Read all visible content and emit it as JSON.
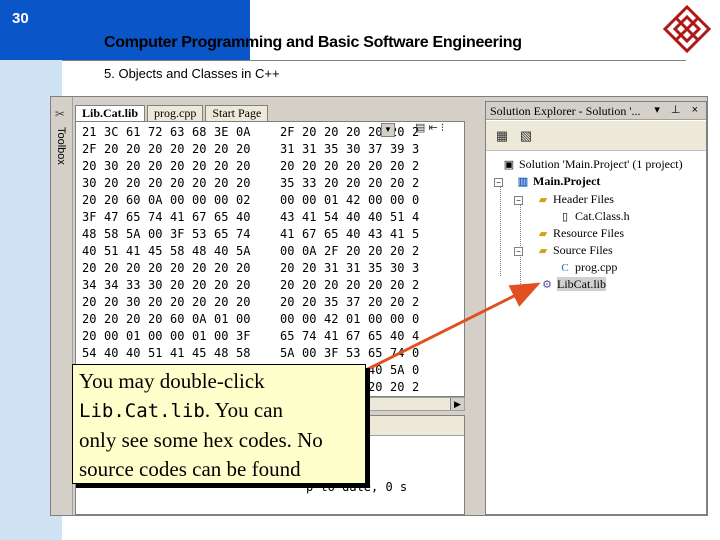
{
  "slide": {
    "number": "30",
    "title": "Computer Programming and Basic Software Engineering",
    "subtitle": "5. Objects and Classes in C++"
  },
  "editor": {
    "tabs": [
      {
        "label": "Lib.Cat.lib",
        "active": true
      },
      {
        "label": "prog.cpp",
        "active": false
      },
      {
        "label": "Start Page",
        "active": false
      }
    ],
    "toolbox_label": "Toolbox",
    "hex_rows": [
      [
        "21",
        "3C",
        "61",
        "72",
        "63",
        "68",
        "3E",
        "0A",
        "",
        "2F",
        "20",
        "20",
        "20",
        "20",
        "20",
        "2"
      ],
      [
        "2F",
        "20",
        "20",
        "20",
        "20",
        "20",
        "20",
        "20",
        "",
        "31",
        "31",
        "35",
        "30",
        "37",
        "39",
        "3"
      ],
      [
        "20",
        "30",
        "20",
        "20",
        "20",
        "20",
        "20",
        "20",
        "",
        "20",
        "20",
        "20",
        "20",
        "20",
        "20",
        "2"
      ],
      [
        "30",
        "20",
        "20",
        "20",
        "20",
        "20",
        "20",
        "20",
        "",
        "35",
        "33",
        "20",
        "20",
        "20",
        "20",
        "2"
      ],
      [
        "20",
        "20",
        "60",
        "0A",
        "00",
        "00",
        "00",
        "02",
        "",
        "00",
        "00",
        "01",
        "42",
        "00",
        "00",
        "0"
      ],
      [
        "3F",
        "47",
        "65",
        "74",
        "41",
        "67",
        "65",
        "40",
        "",
        "43",
        "41",
        "54",
        "40",
        "40",
        "51",
        "4"
      ],
      [
        "48",
        "58",
        "5A",
        "00",
        "3F",
        "53",
        "65",
        "74",
        "",
        "41",
        "67",
        "65",
        "40",
        "43",
        "41",
        "5"
      ],
      [
        "40",
        "51",
        "41",
        "45",
        "58",
        "48",
        "40",
        "5A",
        "",
        "00",
        "0A",
        "2F",
        "20",
        "20",
        "20",
        "2"
      ],
      [
        "20",
        "20",
        "20",
        "20",
        "20",
        "20",
        "20",
        "20",
        "",
        "20",
        "20",
        "31",
        "31",
        "35",
        "30",
        "3"
      ],
      [
        "34",
        "34",
        "33",
        "30",
        "20",
        "20",
        "20",
        "20",
        "",
        "20",
        "20",
        "20",
        "20",
        "20",
        "20",
        "2"
      ],
      [
        "20",
        "20",
        "30",
        "20",
        "20",
        "20",
        "20",
        "20",
        "",
        "20",
        "20",
        "35",
        "37",
        "20",
        "20",
        "2"
      ],
      [
        "20",
        "20",
        "20",
        "20",
        "60",
        "0A",
        "01",
        "00",
        "",
        "00",
        "00",
        "42",
        "01",
        "00",
        "00",
        "0"
      ],
      [
        "20",
        "00",
        "01",
        "00",
        "00",
        "01",
        "00",
        "3F",
        "",
        "65",
        "74",
        "41",
        "67",
        "65",
        "40",
        "4"
      ],
      [
        "54",
        "40",
        "40",
        "51",
        "41",
        "45",
        "48",
        "58",
        "",
        "5A",
        "00",
        "3F",
        "53",
        "65",
        "74",
        "0"
      ],
      [
        "",
        "",
        "",
        "",
        "",
        "",
        "",
        "",
        "",
        "",
        "",
        "",
        "48",
        "40",
        "5A",
        "0"
      ],
      [
        "",
        "",
        "",
        "",
        "",
        "",
        "",
        "",
        "",
        "",
        "",
        "",
        "20",
        "20",
        "20",
        "2"
      ]
    ]
  },
  "output": {
    "text": "p-to-date, 0 s"
  },
  "solution_explorer": {
    "title": "Solution Explorer - Solution '...",
    "title_buttons": "▾ ⊥ ×",
    "root": "Solution 'Main.Project' (1 project)",
    "project": "Main.Project",
    "header_files": "Header Files",
    "cat_class_h": "Cat.Class.h",
    "resource_files": "Resource Files",
    "source_files": "Source Files",
    "prog_cpp": "prog.cpp",
    "libcat_lib": "LibCat.lib"
  },
  "callout": {
    "line1": "You may double-click",
    "code": "Lib.Cat.lib",
    "line2_rest": ". You can",
    "line3": "only see some hex codes. No",
    "line4": "source codes can be found"
  },
  "colors": {
    "title_band": "#0a55c8",
    "side_band": "#cfe3f5",
    "callout_bg": "#ffffcc",
    "arrow": "#e05020",
    "logo": "#b01818"
  }
}
